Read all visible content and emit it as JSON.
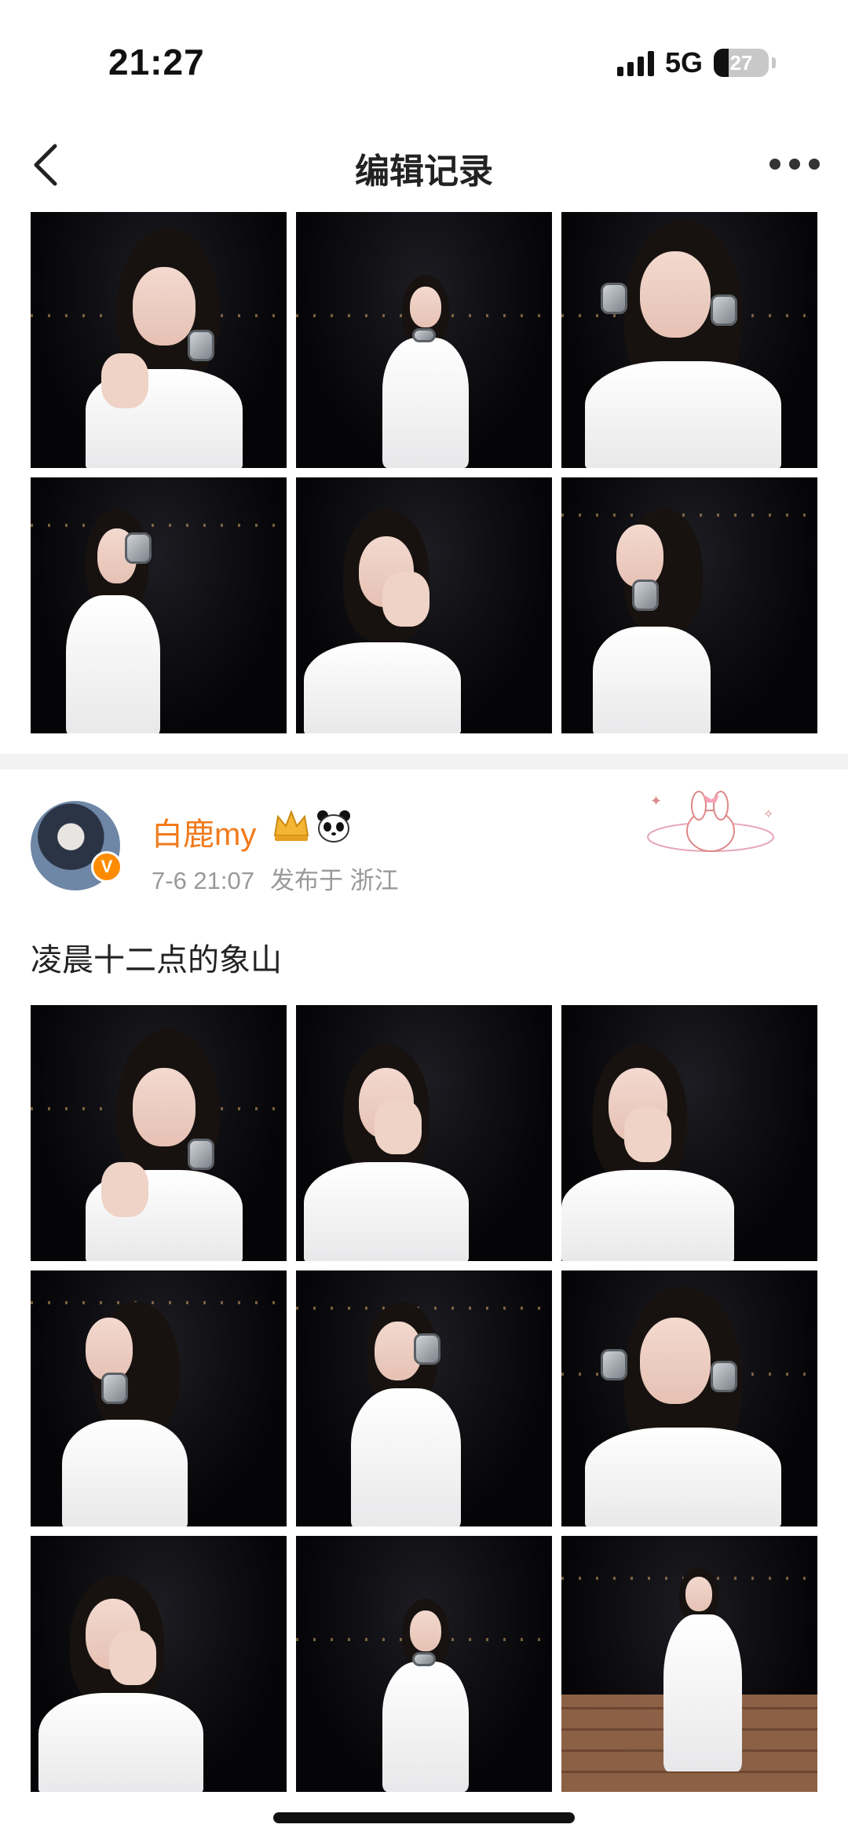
{
  "status_bar": {
    "time": "21:27",
    "network": "5G",
    "battery": "27",
    "battery_level_percent": 27
  },
  "nav": {
    "title": "编辑记录",
    "back_icon": "chevron-left-icon",
    "more_icon": "more-dots-icon"
  },
  "post": {
    "username": "白鹿my",
    "badges": [
      "crown-badge-icon",
      "panda-icon"
    ],
    "verified_icon": "verified-v-icon",
    "date": "7-6 21:07",
    "location": "发布于 浙江",
    "text": "凌晨十二点的象山"
  },
  "colors": {
    "username": "#f07a1c",
    "meta": "#999999",
    "separator": "#f2f2f2"
  }
}
